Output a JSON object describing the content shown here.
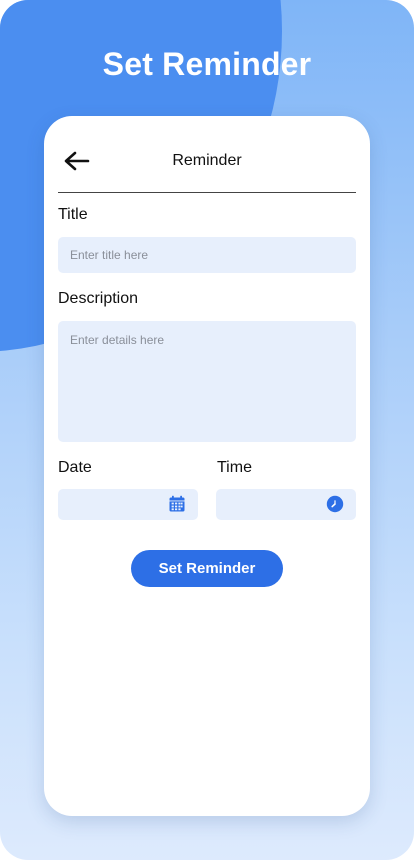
{
  "page": {
    "heading": "Set Reminder"
  },
  "card": {
    "title": "Reminder",
    "back_icon": "arrow-left-icon"
  },
  "form": {
    "title_label": "Title",
    "title_placeholder": "Enter title here",
    "title_value": "",
    "description_label": "Description",
    "description_placeholder": "Enter details here",
    "description_value": "",
    "date_label": "Date",
    "date_value": "",
    "date_icon": "calendar-icon",
    "time_label": "Time",
    "time_value": "",
    "time_icon": "clock-icon",
    "submit_label": "Set Reminder"
  },
  "colors": {
    "accent": "#2d6fe6",
    "background_blob": "#4b8ef0",
    "field_background": "#e7effc"
  }
}
